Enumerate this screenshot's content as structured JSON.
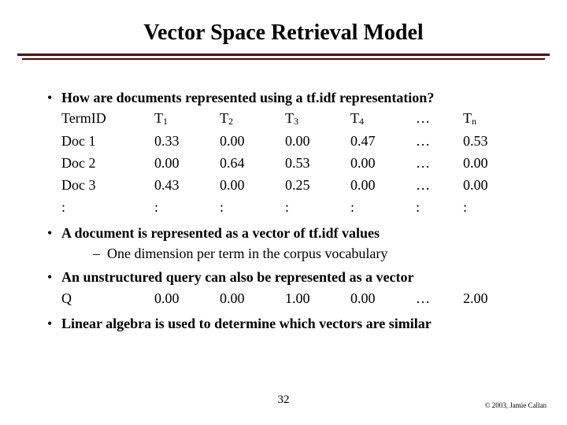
{
  "title": "Vector Space Retrieval Model",
  "bullets": {
    "b1": "How are documents represented using a tf.idf representation?",
    "b2": "A document is represented as a vector of tf.idf values",
    "b2_sub": "One dimension per term in the corpus vocabulary",
    "b3": "An unstructured query can also be represented as a vector",
    "b4": "Linear algebra is used to determine which vectors are similar"
  },
  "table": {
    "header": {
      "label": "TermID",
      "t1_base": "T",
      "t1_sub": "1",
      "t2_base": "T",
      "t2_sub": "2",
      "t3_base": "T",
      "t3_sub": "3",
      "t4_base": "T",
      "t4_sub": "4",
      "dots": "…",
      "tn_base": "T",
      "tn_sub": "n"
    },
    "rows": [
      {
        "label": "Doc 1",
        "c1": "0.33",
        "c2": "0.00",
        "c3": "0.00",
        "c4": "0.47",
        "dots": "…",
        "cn": "0.53"
      },
      {
        "label": "Doc 2",
        "c1": "0.00",
        "c2": "0.64",
        "c3": "0.53",
        "c4": "0.00",
        "dots": "…",
        "cn": "0.00"
      },
      {
        "label": "Doc 3",
        "c1": "0.43",
        "c2": "0.00",
        "c3": "0.25",
        "c4": "0.00",
        "dots": "…",
        "cn": "0.00"
      },
      {
        "label": ":",
        "c1": ":",
        "c2": ":",
        "c3": ":",
        "c4": ":",
        "dots": ":",
        "cn": ":"
      }
    ],
    "query": {
      "label": "Q",
      "c1": "0.00",
      "c2": "0.00",
      "c3": "1.00",
      "c4": "0.00",
      "dots": "…",
      "cn": "2.00"
    }
  },
  "footer": {
    "page": "32",
    "copyright": "© 2003, Jamie Callan"
  },
  "glyphs": {
    "bullet": "•",
    "dash": "–"
  }
}
